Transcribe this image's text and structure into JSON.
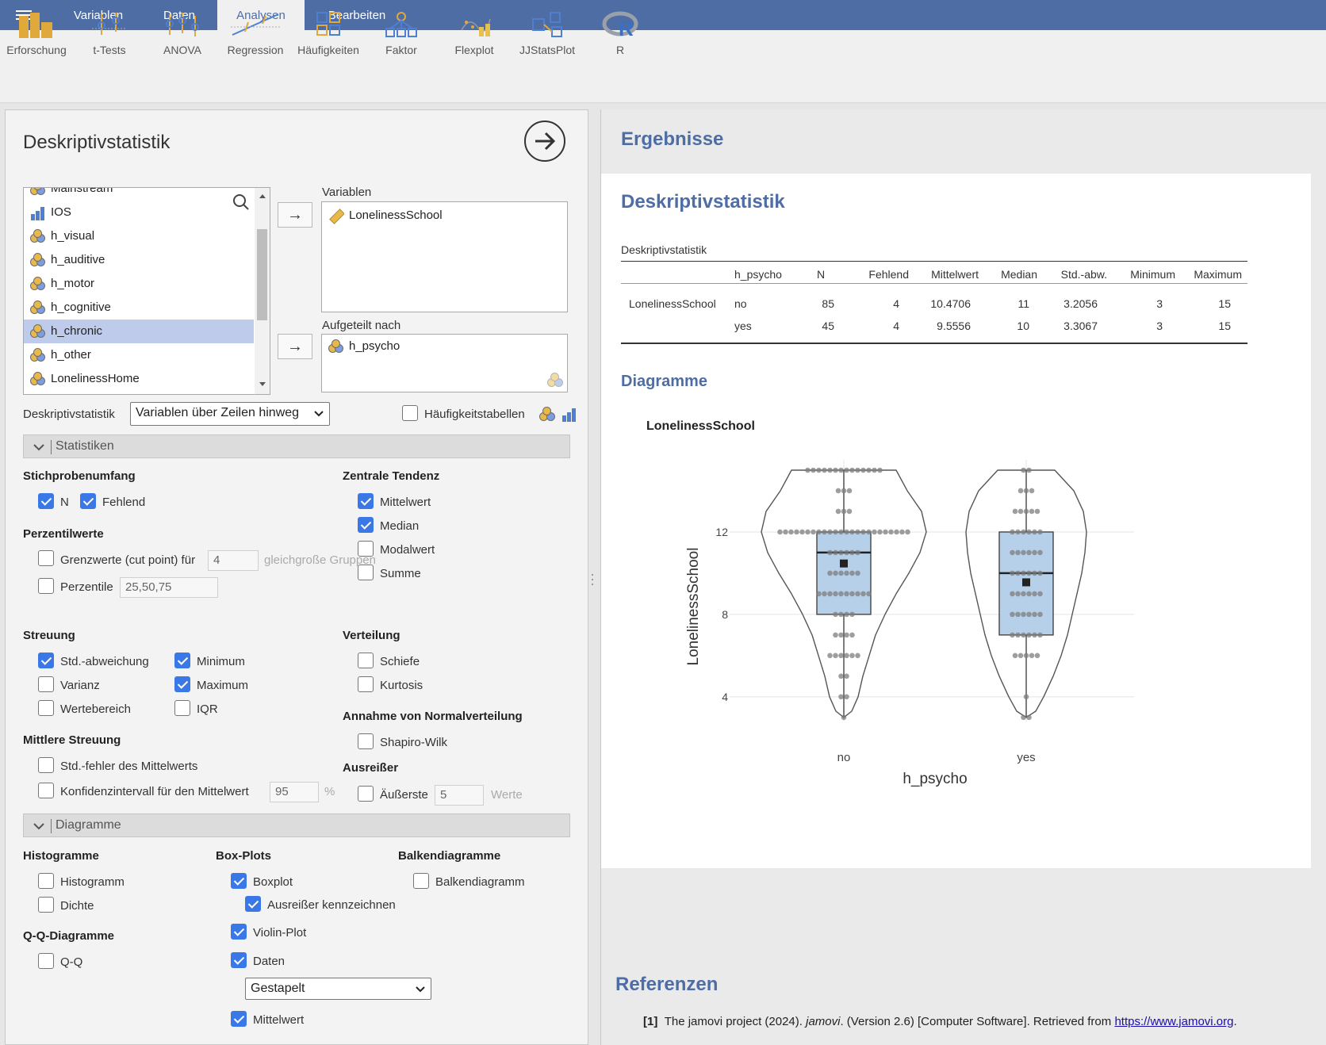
{
  "topbar": {
    "tabs": [
      "Variablen",
      "Daten",
      "Analysen",
      "Bearbeiten"
    ]
  },
  "ribbon": {
    "items": [
      "Erforschung",
      "t-Tests",
      "ANOVA",
      "Regression",
      "Häufigkeiten",
      "Faktor",
      "Flexplot",
      "JJStatsPlot",
      "R"
    ],
    "accent_color": "#4e6da4",
    "icon_color_orange": "#e0a93b",
    "icon_color_blue": "#4e7fd1"
  },
  "analysis": {
    "title": "Deskriptivstatistik",
    "variable_list": [
      "Mainstream",
      "IOS",
      "h_visual",
      "h_auditive",
      "h_motor",
      "h_cognitive",
      "h_chronic",
      "h_other",
      "LonelinessHome"
    ],
    "selected_variable": "h_chronic",
    "variables_label": "Variablen",
    "variables": [
      "LonelinessSchool"
    ],
    "split_label": "Aufgeteilt nach",
    "split_by": [
      "h_psycho"
    ],
    "desc_label": "Deskriptivstatistik",
    "desc_select": "Variablen über Zeilen hinweg",
    "freq_tables": "Häufigkeitstabellen"
  },
  "statistics": {
    "section": "Statistiken",
    "sample_size": "Stichprobenumfang",
    "n": "N",
    "missing": "Fehlend",
    "percentiles": "Perzentilwerte",
    "cut_points": "Grenzwerte (cut point) für",
    "cut_value": "4",
    "cut_suffix": "gleichgroße Gruppen",
    "percentile": "Perzentile",
    "percentile_value": "25,50,75",
    "central": "Zentrale Tendenz",
    "mean": "Mittelwert",
    "median": "Median",
    "mode": "Modalwert",
    "sum": "Summe",
    "dispersion": "Streuung",
    "sd": "Std.-abweichung",
    "min": "Minimum",
    "variance": "Varianz",
    "max": "Maximum",
    "range": "Wertebereich",
    "iqr": "IQR",
    "distribution": "Verteilung",
    "skew": "Schiefe",
    "kurtosis": "Kurtosis",
    "normality": "Annahme von Normalverteilung",
    "shapiro": "Shapiro-Wilk",
    "mean_disp": "Mittlere Streuung",
    "se": "Std.-fehler des Mittelwerts",
    "ci": "Konfidenzintervall für den Mittelwert",
    "ci_value": "95",
    "ci_unit": "%",
    "outliers": "Ausreißer",
    "extreme": "Äußerste",
    "extreme_value": "5",
    "extreme_unit": "Werte"
  },
  "plots": {
    "section": "Diagramme",
    "histograms": "Histogramme",
    "histogram": "Histogramm",
    "density": "Dichte",
    "qq_head": "Q-Q-Diagramme",
    "qq": "Q-Q",
    "boxplots": "Box-Plots",
    "boxplot": "Boxplot",
    "label_outliers": "Ausreißer kennzeichnen",
    "violin": "Violin-Plot",
    "data": "Daten",
    "data_select": "Gestapelt",
    "mean": "Mittelwert",
    "bar_head": "Balkendiagramme",
    "bar": "Balkendiagramm"
  },
  "results": {
    "heading": "Ergebnisse",
    "title": "Deskriptivstatistik",
    "table_caption": "Deskriptivstatistik",
    "columns": [
      "h_psycho",
      "N",
      "Fehlend",
      "Mittelwert",
      "Median",
      "Std.-abw.",
      "Minimum",
      "Maximum"
    ],
    "rows": [
      [
        "LonelinessSchool",
        "no",
        "85",
        "4",
        "10.4706",
        "11",
        "3.2056",
        "3",
        "15"
      ],
      [
        "",
        "yes",
        "45",
        "4",
        "9.5556",
        "10",
        "3.3067",
        "3",
        "15"
      ]
    ],
    "plots_heading": "Diagramme",
    "plot_title": "LonelinessSchool"
  },
  "chart_data": {
    "type": "box",
    "title": "LonelinessSchool",
    "xlabel": "h_psycho",
    "ylabel": "LonelinessSchool",
    "categories": [
      "no",
      "yes"
    ],
    "y_ticks": [
      4,
      8,
      12
    ],
    "ylim": [
      3,
      15
    ],
    "boxes": [
      {
        "name": "no",
        "min": 3,
        "q1": 8,
        "median": 11,
        "q3": 12,
        "max": 15,
        "mean": 10.4706
      },
      {
        "name": "yes",
        "min": 3,
        "q1": 7,
        "median": 10,
        "q3": 12,
        "max": 15,
        "mean": 9.5556
      }
    ],
    "violin": true,
    "data_points": "stacked",
    "box_color": "#b6d0ea"
  },
  "references": {
    "heading": "Referenzen",
    "num": "[1]",
    "text_a": "The jamovi project (2024). ",
    "text_b": "jamovi",
    "text_c": ". (Version 2.6) [Computer Software]. Retrieved from ",
    "link": "https://www.jamovi.org",
    "text_d": "."
  }
}
